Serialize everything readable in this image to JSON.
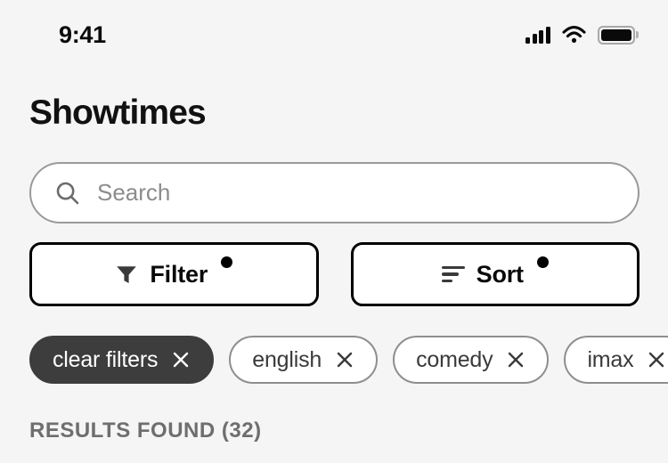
{
  "status_bar": {
    "time": "9:41",
    "cellular_icon": "cellular-signal-icon",
    "wifi_icon": "wifi-icon",
    "battery_icon": "battery-full-icon"
  },
  "header": {
    "title": "Showtimes"
  },
  "search": {
    "icon": "search-icon",
    "placeholder": "Search",
    "value": ""
  },
  "actions": [
    {
      "label": "Filter",
      "icon": "filter-funnel-icon",
      "badge": true
    },
    {
      "label": "Sort",
      "icon": "sort-lines-icon",
      "badge": true
    }
  ],
  "chips": [
    {
      "label": "clear filters",
      "style": "active",
      "close_icon": "close-icon"
    },
    {
      "label": "english",
      "style": "outline",
      "close_icon": "close-icon"
    },
    {
      "label": "comedy",
      "style": "outline",
      "close_icon": "close-icon"
    },
    {
      "label": "imax",
      "style": "outline",
      "close_icon": "close-icon"
    }
  ],
  "results": {
    "label": "RESULTS FOUND (32)",
    "count": 32
  },
  "colors": {
    "background": "#f5f5f5",
    "text_primary": "#111111",
    "text_muted": "#6e6e6e",
    "chip_active_bg": "#3d3d3d",
    "border_strong": "#000000",
    "badge": "#000000"
  }
}
